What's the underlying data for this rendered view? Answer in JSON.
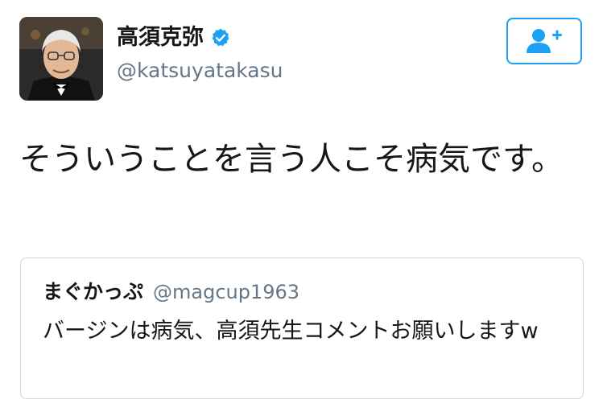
{
  "author": {
    "display_name": "高須克弥",
    "handle": "@katsuyatakasu",
    "verified": true,
    "avatar": "profile-photo"
  },
  "follow_button": {
    "icon": "add-user-icon"
  },
  "tweet": {
    "text": "そういうことを言う人こそ病気です。"
  },
  "quoted_tweet": {
    "display_name": "まぐかっぷ",
    "handle": "@magcup1963",
    "text": "バージンは病気、高須先生コメントお願いしますw"
  },
  "colors": {
    "accent": "#1da1f2",
    "text_primary": "#14171a",
    "text_secondary": "#657786",
    "border": "#ccd6dd"
  }
}
